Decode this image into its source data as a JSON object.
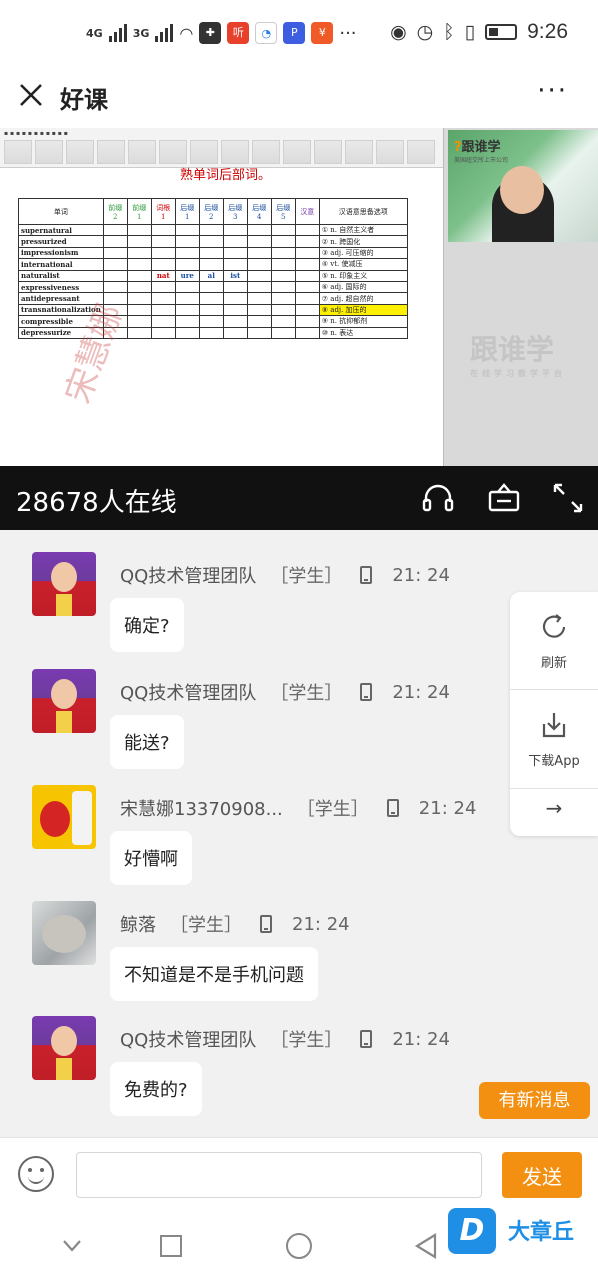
{
  "status": {
    "sig1": "4G",
    "sig2": "3G",
    "time": "9:26"
  },
  "titlebar": {
    "title": "好课",
    "more": "···"
  },
  "video": {
    "doc_heading": "熟单词后部词。",
    "table_header": [
      "单词",
      "前缀 2",
      "前缀 1",
      "词根 1",
      "后缀 1",
      "后缀 2",
      "后缀 3",
      "后缀 4",
      "后缀 5",
      "汉意",
      "汉语意思备选项"
    ],
    "words": [
      "supernatural",
      "pressurized",
      "impressionism",
      "international",
      "naturalist",
      "expressiveness",
      "antidepressant",
      "transnationalization",
      "compressible",
      "depressurize"
    ],
    "naturalist_parts": [
      "nat",
      "ure",
      "al",
      "ist"
    ],
    "options": [
      "① n. 自然主义者",
      "② n. 跨国化",
      "③ adj. 可压缩的",
      "④ vt. 使减压",
      "⑤ n. 印象主义",
      "⑥ adj. 国际的",
      "⑦ adj. 超自然的",
      "⑧ adj. 加压的",
      "⑨ n. 抗抑郁剂",
      "⑩ n. 表达"
    ],
    "teacher_logo": "跟谁学",
    "teacher_logo_sub": "美国纽交所上市公司",
    "brand_watermark": "跟谁学",
    "brand_watermark_sub": "在线学习教学平台",
    "name_watermark": "宋慧娜"
  },
  "online": {
    "count_text": "28678人在线"
  },
  "messages": [
    {
      "name": "QQ技术管理团队",
      "role": "［学生］",
      "time": "21: 24",
      "text": "确定?"
    },
    {
      "name": "QQ技术管理团队",
      "role": "［学生］",
      "time": "21: 24",
      "text": "能送?"
    },
    {
      "name": "宋慧娜13370908...",
      "role": "［学生］",
      "time": "21: 24",
      "text": "好懵啊"
    },
    {
      "name": "鲸落",
      "role": "［学生］",
      "time": "21: 24",
      "text": "不知道是不是手机问题"
    },
    {
      "name": "QQ技术管理团队",
      "role": "［学生］",
      "time": "21: 24",
      "text": "免费的?"
    }
  ],
  "side": {
    "refresh_label": "刷新",
    "download_label": "下载App",
    "arrow": "→"
  },
  "new_message_label": "有新消息",
  "input": {
    "placeholder": "",
    "send_label": "发送"
  },
  "watermark": {
    "letter": "D",
    "text": "大章丘"
  }
}
